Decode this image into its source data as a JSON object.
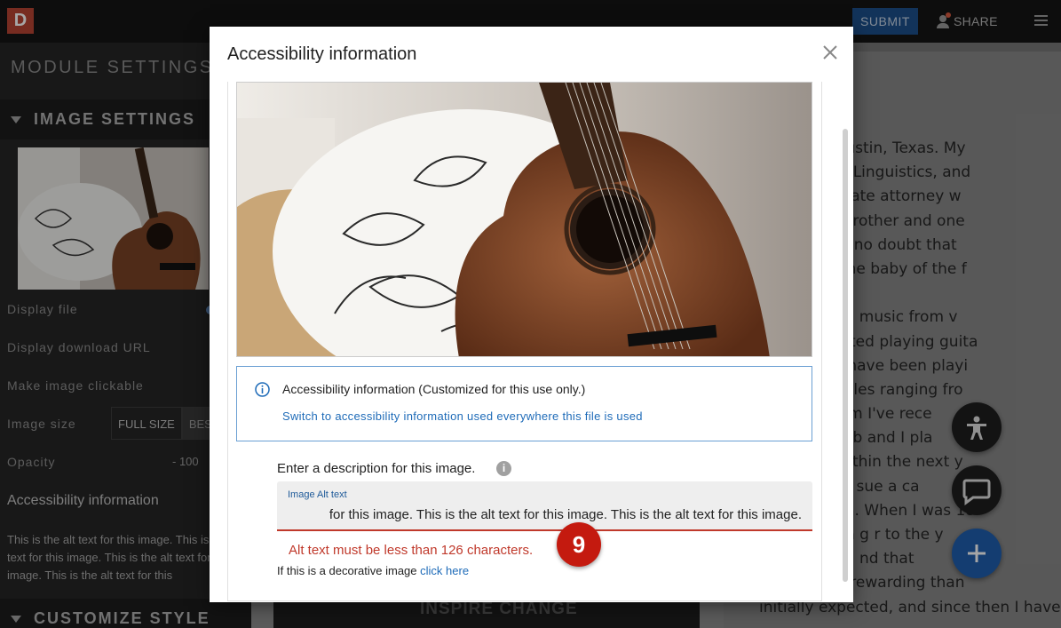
{
  "topbar": {
    "logo_letter": "D",
    "submit_label": "SUBMIT",
    "share_label": "SHARE",
    "colors": {
      "submit_bg": "#1c4f8a",
      "logo_bg": "#b74433"
    }
  },
  "left_panel": {
    "title": "MODULE SETTINGS",
    "image_settings_header": "IMAGE SETTINGS",
    "rows": {
      "display_file": "Display file",
      "display_download_url": "Display download URL",
      "make_image_clickable": "Make image clickable",
      "image_size": "Image size",
      "opacity": "Opacity"
    },
    "size_options": {
      "full": "FULL SIZE",
      "best": "BES"
    },
    "opacity_value": "-   100",
    "accessibility_label": "Accessibility information",
    "alt_preview": "This is the alt text for this image. This is the alt text for this image. This is the alt text for this image. This is the alt text for this",
    "customize_header": "CUSTOMIZE STYLE"
  },
  "page_preview": {
    "lines": [
      "n 2000 in Austin, Texas. My",
      "Professor of Linguistics, and",
      "ks as a probate attorney w",
      " I have one brother and one",
      "and there is no doubt that",
      "rom being the baby of the f",
      "",
      " interested in music from v",
      "e, and I started playing guita",
      "years old. I have been playi",
      "e then in styles ranging fro",
      "rock and flam      I've rece",
      "ning the keyb      and I pla",
      "ng drums within the next y",
      "ally planned      sue a ca",
      "nal musician. When I was 18",
      "nity to teach g   r to the y",
      " family friend    nd that",
      "much more rewarding than",
      "initially expected, and since then I have"
    ],
    "banner_text": "INSPIRE CHANGE"
  },
  "modal": {
    "title": "Accessibility information",
    "info_text": "Accessibility information (Customized for this use only.)",
    "info_link": "Switch to accessibility information used everywhere this file is used",
    "description_label": "Enter a description for this image.",
    "field_label": "Image Alt text",
    "field_value": "for this image. This is the alt text for this image. This is the alt text for this image.",
    "error_text": "Alt text must be less than 126 characters.",
    "badge_number": "9",
    "decorative_text": "If this is a decorative image",
    "decorative_link": "click here",
    "colors": {
      "error": "#c0392b",
      "link": "#1e6bb8",
      "badge": "#c41a0f"
    }
  }
}
